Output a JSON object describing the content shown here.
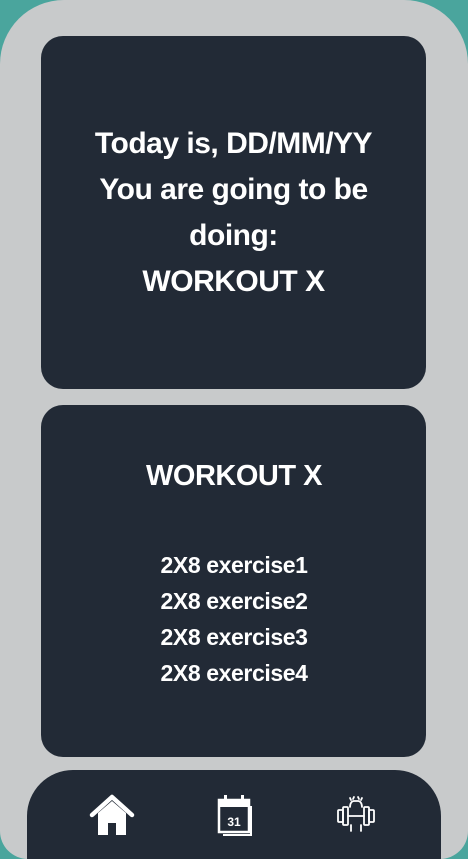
{
  "greeting_card": {
    "lines": [
      "Today is, DD/MM/YY",
      "You are going to be",
      "doing:",
      "WORKOUT X"
    ]
  },
  "workout_card": {
    "title": "WORKOUT X",
    "exercises": [
      "2X8 exercise1",
      "2X8 exercise2",
      "2X8 exercise3",
      "2X8 exercise4"
    ]
  },
  "nav": {
    "calendar_day": "31",
    "items": [
      {
        "icon": "home-icon"
      },
      {
        "icon": "calendar-icon"
      },
      {
        "icon": "workout-icon"
      }
    ]
  },
  "colors": {
    "background": "#4aa59d",
    "frame": "#c8cacb",
    "card": "#222a36",
    "text": "#ffffff"
  }
}
